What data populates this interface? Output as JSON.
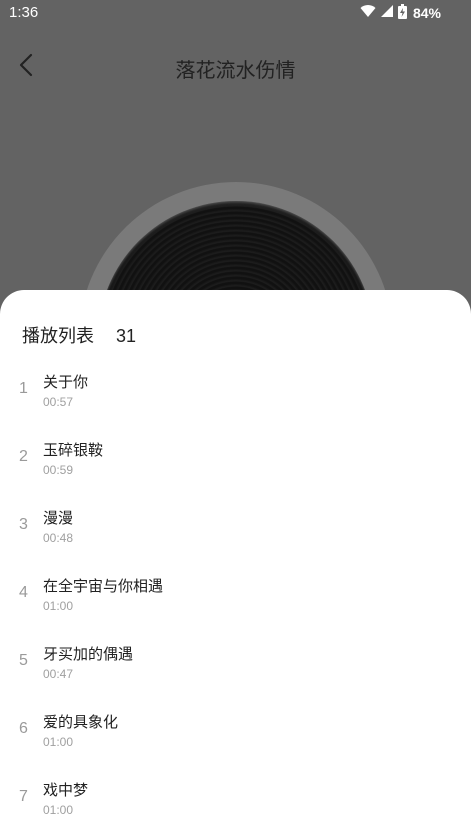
{
  "status_bar": {
    "time": "1:36",
    "battery": "84%"
  },
  "header": {
    "title": "落花流水伤情"
  },
  "playlist": {
    "title": "播放列表",
    "count": "31",
    "tracks": [
      {
        "index": "1",
        "title": "关于你",
        "duration": "00:57"
      },
      {
        "index": "2",
        "title": "玉碎银鞍",
        "duration": "00:59"
      },
      {
        "index": "3",
        "title": "漫漫",
        "duration": "00:48"
      },
      {
        "index": "4",
        "title": "在全宇宙与你相遇",
        "duration": "01:00"
      },
      {
        "index": "5",
        "title": "牙买加的偶遇",
        "duration": "00:47"
      },
      {
        "index": "6",
        "title": "爱的具象化",
        "duration": "01:00"
      },
      {
        "index": "7",
        "title": "戏中梦",
        "duration": "01:00"
      }
    ]
  }
}
